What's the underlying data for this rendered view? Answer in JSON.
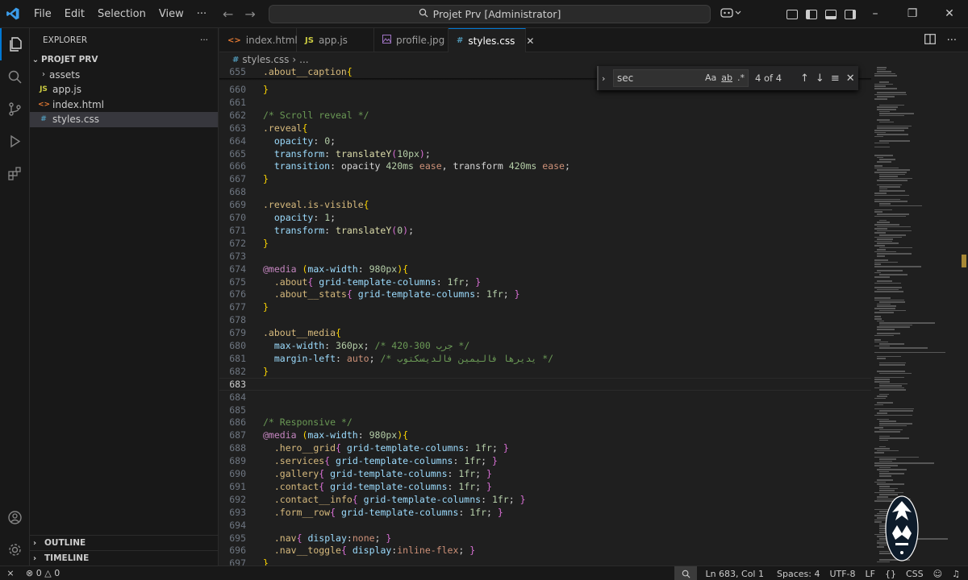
{
  "titlebar": {
    "menu": [
      "File",
      "Edit",
      "Selection",
      "View",
      "···"
    ],
    "command_center": "Projet Prv [Administrator]"
  },
  "explorer": {
    "header": "EXPLORER",
    "project": "PROJET PRV",
    "items": [
      {
        "name": "assets",
        "type": "folder",
        "icon": "folder-chevron"
      },
      {
        "name": "app.js",
        "type": "js",
        "icon": "JS"
      },
      {
        "name": "index.html",
        "type": "html",
        "icon": "<>"
      },
      {
        "name": "styles.css",
        "type": "css",
        "icon": "#",
        "selected": true
      }
    ],
    "outline": "OUTLINE",
    "timeline": "TIMELINE"
  },
  "tabs": [
    {
      "label": "index.html",
      "icon": "<>",
      "icon_color": "#e37933"
    },
    {
      "label": "app.js",
      "icon": "JS",
      "icon_color": "#cbcb41"
    },
    {
      "label": "profile.jpg",
      "icon": "image",
      "icon_color": "#a074c4"
    },
    {
      "label": "styles.css",
      "icon": "#",
      "icon_color": "#519aba",
      "active": true
    }
  ],
  "breadcrumb": {
    "file": "styles.css",
    "rest": "..."
  },
  "find": {
    "query": "sec",
    "case_label": "Aa",
    "word_label": "ab",
    "regex_label": ".*",
    "count": "4 of 4"
  },
  "editor": {
    "current_line": 683,
    "sticky_line": {
      "n": 655,
      "tokens": [
        [
          "sel",
          ".about__caption"
        ],
        [
          "b1",
          "{"
        ]
      ]
    },
    "lines": [
      {
        "n": 660,
        "tokens": [
          [
            "b1",
            "}"
          ]
        ]
      },
      {
        "n": 661,
        "tokens": []
      },
      {
        "n": 662,
        "tokens": [
          [
            "cm",
            "/* Scroll reveal */"
          ]
        ]
      },
      {
        "n": 663,
        "tokens": [
          [
            "sel",
            ".reveal"
          ],
          [
            "b1",
            "{"
          ]
        ]
      },
      {
        "n": 664,
        "tokens": [
          [
            "t",
            "  "
          ],
          [
            "prop",
            "opacity"
          ],
          [
            "t",
            ": "
          ],
          [
            "num",
            "0"
          ],
          [
            "t",
            ";"
          ]
        ]
      },
      {
        "n": 665,
        "tokens": [
          [
            "t",
            "  "
          ],
          [
            "prop",
            "transform"
          ],
          [
            "t",
            ": "
          ],
          [
            "fn",
            "translateY"
          ],
          [
            "b2",
            "("
          ],
          [
            "num",
            "10px"
          ],
          [
            "b2",
            ")"
          ],
          [
            "t",
            ";"
          ]
        ]
      },
      {
        "n": 666,
        "tokens": [
          [
            "t",
            "  "
          ],
          [
            "prop",
            "transition"
          ],
          [
            "t",
            ": opacity "
          ],
          [
            "num",
            "420ms"
          ],
          [
            "t",
            " "
          ],
          [
            "kw",
            "ease"
          ],
          [
            "t",
            ", transform "
          ],
          [
            "num",
            "420ms"
          ],
          [
            "t",
            " "
          ],
          [
            "kw",
            "ease"
          ],
          [
            "t",
            ";"
          ]
        ]
      },
      {
        "n": 667,
        "tokens": [
          [
            "b1",
            "}"
          ]
        ]
      },
      {
        "n": 668,
        "tokens": []
      },
      {
        "n": 669,
        "tokens": [
          [
            "sel",
            ".reveal.is-visible"
          ],
          [
            "b1",
            "{"
          ]
        ]
      },
      {
        "n": 670,
        "tokens": [
          [
            "t",
            "  "
          ],
          [
            "prop",
            "opacity"
          ],
          [
            "t",
            ": "
          ],
          [
            "num",
            "1"
          ],
          [
            "t",
            ";"
          ]
        ]
      },
      {
        "n": 671,
        "tokens": [
          [
            "t",
            "  "
          ],
          [
            "prop",
            "transform"
          ],
          [
            "t",
            ": "
          ],
          [
            "fn",
            "translateY"
          ],
          [
            "b2",
            "("
          ],
          [
            "num",
            "0"
          ],
          [
            "b2",
            ")"
          ],
          [
            "t",
            ";"
          ]
        ]
      },
      {
        "n": 672,
        "tokens": [
          [
            "b1",
            "}"
          ]
        ]
      },
      {
        "n": 673,
        "tokens": []
      },
      {
        "n": 674,
        "tokens": [
          [
            "at",
            "@media"
          ],
          [
            "t",
            " "
          ],
          [
            "b1",
            "("
          ],
          [
            "prop",
            "max-width"
          ],
          [
            "t",
            ": "
          ],
          [
            "num",
            "980px"
          ],
          [
            "b1",
            ")"
          ],
          [
            "b1",
            "{"
          ]
        ]
      },
      {
        "n": 675,
        "tokens": [
          [
            "t",
            "  "
          ],
          [
            "sel",
            ".about"
          ],
          [
            "b2",
            "{"
          ],
          [
            "t",
            " "
          ],
          [
            "prop",
            "grid-template-columns"
          ],
          [
            "t",
            ": "
          ],
          [
            "num",
            "1fr"
          ],
          [
            "t",
            "; "
          ],
          [
            "b2",
            "}"
          ]
        ]
      },
      {
        "n": 676,
        "tokens": [
          [
            "t",
            "  "
          ],
          [
            "sel",
            ".about__stats"
          ],
          [
            "b2",
            "{"
          ],
          [
            "t",
            " "
          ],
          [
            "prop",
            "grid-template-columns"
          ],
          [
            "t",
            ": "
          ],
          [
            "num",
            "1fr"
          ],
          [
            "t",
            "; "
          ],
          [
            "b2",
            "}"
          ]
        ]
      },
      {
        "n": 677,
        "tokens": [
          [
            "b1",
            "}"
          ]
        ]
      },
      {
        "n": 678,
        "tokens": []
      },
      {
        "n": 679,
        "tokens": [
          [
            "sel",
            ".about__media"
          ],
          [
            "b1",
            "{"
          ]
        ]
      },
      {
        "n": 680,
        "tokens": [
          [
            "t",
            "  "
          ],
          [
            "prop",
            "max-width"
          ],
          [
            "t",
            ": "
          ],
          [
            "num",
            "360px"
          ],
          [
            "t",
            "; "
          ],
          [
            "cm",
            "/* 420-300 جرب */"
          ]
        ]
      },
      {
        "n": 681,
        "tokens": [
          [
            "t",
            "  "
          ],
          [
            "prop",
            "margin-left"
          ],
          [
            "t",
            ": "
          ],
          [
            "kw",
            "auto"
          ],
          [
            "t",
            "; "
          ],
          [
            "cm",
            "/* يديرها فاليمين فالديسكتوب */"
          ]
        ]
      },
      {
        "n": 682,
        "tokens": [
          [
            "b1",
            "}"
          ]
        ]
      },
      {
        "n": 683,
        "tokens": []
      },
      {
        "n": 684,
        "tokens": []
      },
      {
        "n": 685,
        "tokens": []
      },
      {
        "n": 686,
        "tokens": [
          [
            "cm",
            "/* Responsive */"
          ]
        ]
      },
      {
        "n": 687,
        "tokens": [
          [
            "at",
            "@media"
          ],
          [
            "t",
            " "
          ],
          [
            "b1",
            "("
          ],
          [
            "prop",
            "max-width"
          ],
          [
            "t",
            ": "
          ],
          [
            "num",
            "980px"
          ],
          [
            "b1",
            ")"
          ],
          [
            "b1",
            "{"
          ]
        ]
      },
      {
        "n": 688,
        "tokens": [
          [
            "t",
            "  "
          ],
          [
            "sel",
            ".hero__grid"
          ],
          [
            "b2",
            "{"
          ],
          [
            "t",
            " "
          ],
          [
            "prop",
            "grid-template-columns"
          ],
          [
            "t",
            ": "
          ],
          [
            "num",
            "1fr"
          ],
          [
            "t",
            "; "
          ],
          [
            "b2",
            "}"
          ]
        ]
      },
      {
        "n": 689,
        "tokens": [
          [
            "t",
            "  "
          ],
          [
            "sel",
            ".services"
          ],
          [
            "b2",
            "{"
          ],
          [
            "t",
            " "
          ],
          [
            "prop",
            "grid-template-columns"
          ],
          [
            "t",
            ": "
          ],
          [
            "num",
            "1fr"
          ],
          [
            "t",
            "; "
          ],
          [
            "b2",
            "}"
          ]
        ]
      },
      {
        "n": 690,
        "tokens": [
          [
            "t",
            "  "
          ],
          [
            "sel",
            ".gallery"
          ],
          [
            "b2",
            "{"
          ],
          [
            "t",
            " "
          ],
          [
            "prop",
            "grid-template-columns"
          ],
          [
            "t",
            ": "
          ],
          [
            "num",
            "1fr"
          ],
          [
            "t",
            "; "
          ],
          [
            "b2",
            "}"
          ]
        ]
      },
      {
        "n": 691,
        "tokens": [
          [
            "t",
            "  "
          ],
          [
            "sel",
            ".contact"
          ],
          [
            "b2",
            "{"
          ],
          [
            "t",
            " "
          ],
          [
            "prop",
            "grid-template-columns"
          ],
          [
            "t",
            ": "
          ],
          [
            "num",
            "1fr"
          ],
          [
            "t",
            "; "
          ],
          [
            "b2",
            "}"
          ]
        ]
      },
      {
        "n": 692,
        "tokens": [
          [
            "t",
            "  "
          ],
          [
            "sel",
            ".contact__info"
          ],
          [
            "b2",
            "{"
          ],
          [
            "t",
            " "
          ],
          [
            "prop",
            "grid-template-columns"
          ],
          [
            "t",
            ": "
          ],
          [
            "num",
            "1fr"
          ],
          [
            "t",
            "; "
          ],
          [
            "b2",
            "}"
          ]
        ]
      },
      {
        "n": 693,
        "tokens": [
          [
            "t",
            "  "
          ],
          [
            "sel",
            ".form__row"
          ],
          [
            "b2",
            "{"
          ],
          [
            "t",
            " "
          ],
          [
            "prop",
            "grid-template-columns"
          ],
          [
            "t",
            ": "
          ],
          [
            "num",
            "1fr"
          ],
          [
            "t",
            "; "
          ],
          [
            "b2",
            "}"
          ]
        ]
      },
      {
        "n": 694,
        "tokens": []
      },
      {
        "n": 695,
        "tokens": [
          [
            "t",
            "  "
          ],
          [
            "sel",
            ".nav"
          ],
          [
            "b2",
            "{"
          ],
          [
            "t",
            " "
          ],
          [
            "prop",
            "display"
          ],
          [
            "t",
            ":"
          ],
          [
            "kw",
            "none"
          ],
          [
            "t",
            "; "
          ],
          [
            "b2",
            "}"
          ]
        ]
      },
      {
        "n": 696,
        "tokens": [
          [
            "t",
            "  "
          ],
          [
            "sel",
            ".nav__toggle"
          ],
          [
            "b2",
            "{"
          ],
          [
            "t",
            " "
          ],
          [
            "prop",
            "display"
          ],
          [
            "t",
            ":"
          ],
          [
            "kw",
            "inline-flex"
          ],
          [
            "t",
            "; "
          ],
          [
            "b2",
            "}"
          ]
        ]
      },
      {
        "n": 697,
        "tokens": [
          [
            "b1",
            "}"
          ]
        ]
      }
    ]
  },
  "statusbar": {
    "errors": "0",
    "warnings": "0",
    "position": "Ln 683, Col 1",
    "spaces": "Spaces: 4",
    "encoding": "UTF-8",
    "eol": "LF",
    "language": "CSS"
  },
  "colors": {
    "accent": "#0078d4",
    "editor_bg": "#1f1f1f",
    "chrome_bg": "#181818"
  }
}
